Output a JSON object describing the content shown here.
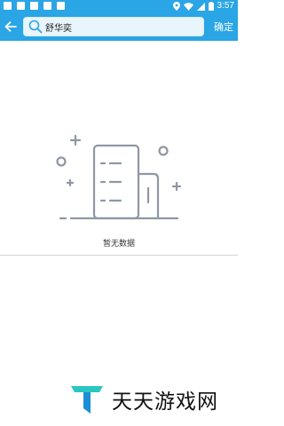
{
  "status_bar": {
    "time": "3:57"
  },
  "header": {
    "back_icon": "arrow-left-icon",
    "search": {
      "value": "舒华奕",
      "icon": "search-icon"
    },
    "confirm_label": "确定"
  },
  "empty_state": {
    "illustration": "building-icon",
    "message": "暂无数据"
  },
  "watermark": {
    "text": "天天游戏网"
  },
  "colors": {
    "primary": "#2aa5e6",
    "search_bg": "#e9f5fc",
    "illustration_gray": "#8f97a3"
  }
}
